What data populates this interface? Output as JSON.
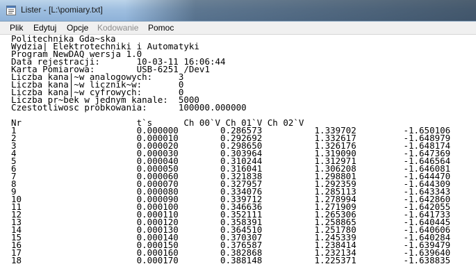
{
  "window": {
    "title": "Lister - [L:\\pomiary.txt]"
  },
  "menu": {
    "items": [
      {
        "label": "Plik",
        "enabled": true
      },
      {
        "label": "Edytuj",
        "enabled": true
      },
      {
        "label": "Opcje",
        "enabled": true
      },
      {
        "label": "Kodowanie",
        "enabled": false
      },
      {
        "label": "Pomoc",
        "enabled": true
      }
    ]
  },
  "document": {
    "header_lines": [
      "Politechnika Gda~ska",
      "Wydzia| Elektrotechniki i Automatyki",
      "Program NewDAQ wersja 1.0",
      "Data rejestracji:       10-03-11 16:06:44",
      "Karta Pomiarowa:        USB-6251 /Dev1",
      "Liczba kana|~w analogowych:     3",
      "Liczba kana|~w licznik~w:       0",
      "Liczba kana|~w cyfrowych:       0",
      "Liczba pr~bek w jednym kanale:  5000",
      "Czestotliwosc probkowania:      100000.000000"
    ],
    "column_header": "Nr                      t`s      Ch 00`V Ch 01`V Ch 02`V",
    "rows": [
      [
        "1",
        "0.000000",
        "0.286573",
        "1.339702",
        "-1.650106"
      ],
      [
        "2",
        "0.000010",
        "0.292692",
        "1.332617",
        "-1.648979"
      ],
      [
        "3",
        "0.000020",
        "0.298650",
        "1.326176",
        "-1.648174"
      ],
      [
        "4",
        "0.000030",
        "0.303964",
        "1.319090",
        "-1.647369"
      ],
      [
        "5",
        "0.000040",
        "0.310244",
        "1.312971",
        "-1.646564"
      ],
      [
        "6",
        "0.000050",
        "0.316041",
        "1.306208",
        "-1.646081"
      ],
      [
        "7",
        "0.000060",
        "0.321838",
        "1.298801",
        "-1.644470"
      ],
      [
        "8",
        "0.000070",
        "0.327957",
        "1.292359",
        "-1.644309"
      ],
      [
        "9",
        "0.000080",
        "0.334076",
        "1.285113",
        "-1.643343"
      ],
      [
        "10",
        "0.000090",
        "0.339712",
        "1.278994",
        "-1.642860"
      ],
      [
        "11",
        "0.000100",
        "0.346636",
        "1.271909",
        "-1.642055"
      ],
      [
        "12",
        "0.000110",
        "0.352111",
        "1.265306",
        "-1.641733"
      ],
      [
        "13",
        "0.000120",
        "0.358391",
        "1.258865",
        "-1.640445"
      ],
      [
        "14",
        "0.000130",
        "0.364510",
        "1.251780",
        "-1.640606"
      ],
      [
        "15",
        "0.000140",
        "0.370307",
        "1.245339",
        "-1.640284"
      ],
      [
        "16",
        "0.000150",
        "0.376587",
        "1.238414",
        "-1.639479"
      ],
      [
        "17",
        "0.000160",
        "0.382868",
        "1.232134",
        "-1.639640"
      ],
      [
        "18",
        "0.000170",
        "0.388148",
        "1.225371",
        "-1.638835"
      ]
    ]
  }
}
